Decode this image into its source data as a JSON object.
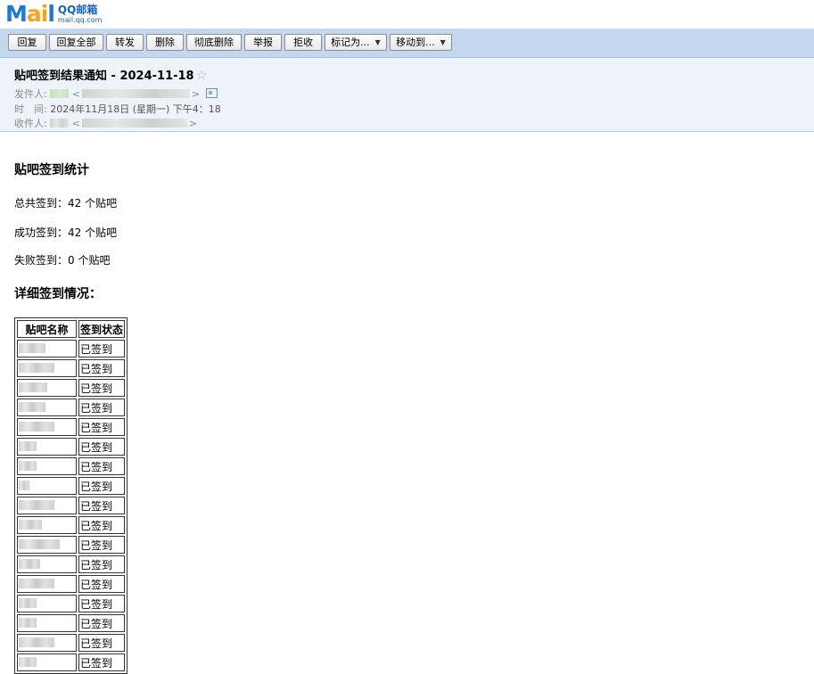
{
  "brand": {
    "word_start": "M",
    "word_accent": "ai",
    "word_end": "l",
    "cn": "QQ邮箱",
    "domain": "mail.qq.com"
  },
  "toolbar": {
    "buttons": [
      {
        "label": "回复"
      },
      {
        "label": "回复全部"
      },
      {
        "label": "转发"
      },
      {
        "label": "删除"
      },
      {
        "label": "彻底删除"
      },
      {
        "label": "举报"
      },
      {
        "label": "拒收"
      },
      {
        "label": "标记为..."
      },
      {
        "label": "移动到..."
      }
    ],
    "caret": "▼"
  },
  "mail": {
    "subject": "贴吧签到结果通知 - 2024-11-18",
    "star": "☆",
    "from_label": "发件人:",
    "time_label": "时　间:",
    "time_value": "2024年11月18日 (星期一) 下午4：18",
    "to_label": "收件人:",
    "lt": "<",
    "gt": ">"
  },
  "body": {
    "heading_stats": "贴吧签到统计",
    "total": "总共签到：42 个贴吧",
    "success": "成功签到：42 个贴吧",
    "failed": "失败签到：0 个贴吧",
    "heading_detail": "详细签到情况：",
    "table": {
      "headers": [
        "贴吧名称",
        "签到状态"
      ],
      "rows": [
        {
          "status": "已签到"
        },
        {
          "status": "已签到"
        },
        {
          "status": "已签到"
        },
        {
          "status": "已签到"
        },
        {
          "status": "已签到"
        },
        {
          "status": "已签到"
        },
        {
          "status": "已签到"
        },
        {
          "status": "已签到"
        },
        {
          "status": "已签到"
        },
        {
          "status": "已签到"
        },
        {
          "status": "已签到"
        },
        {
          "status": "已签到"
        },
        {
          "status": "已签到"
        },
        {
          "status": "已签到"
        },
        {
          "status": "已签到"
        },
        {
          "status": "已签到"
        },
        {
          "status": "已签到"
        }
      ]
    }
  },
  "colors": {
    "toolbar_bg": "#c3d8ee",
    "header_bg": "#eef3fa",
    "logo_blue": "#1a7ad6",
    "logo_orange": "#f6a21b"
  }
}
